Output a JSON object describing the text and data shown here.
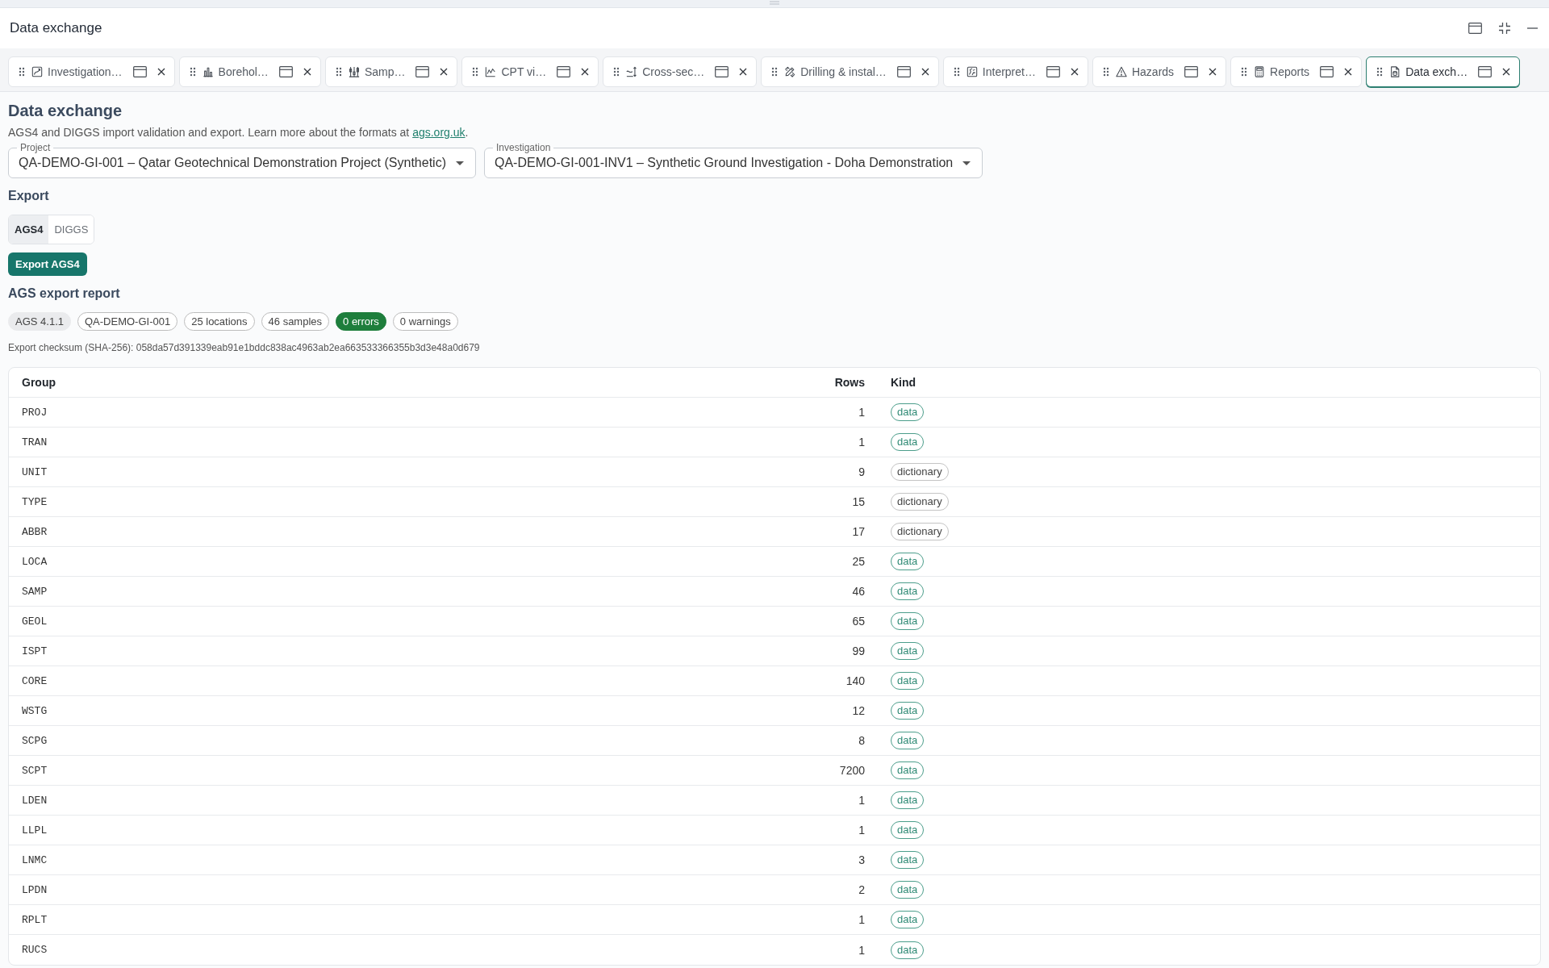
{
  "window": {
    "title": "Data exchange"
  },
  "tabs": [
    {
      "label": "Investigation…",
      "selected": false
    },
    {
      "label": "Borehol…",
      "selected": false
    },
    {
      "label": "Samp…",
      "selected": false
    },
    {
      "label": "CPT vi…",
      "selected": false
    },
    {
      "label": "Cross-sec…",
      "selected": false
    },
    {
      "label": "Drilling & instal…",
      "selected": false
    },
    {
      "label": "Interpret…",
      "selected": false
    },
    {
      "label": "Hazards",
      "selected": false
    },
    {
      "label": "Reports",
      "selected": false
    },
    {
      "label": "Data exch…",
      "selected": true
    }
  ],
  "page": {
    "heading": "Data exchange",
    "description": "AGS4 and DIGGS import validation and export. Learn more about the formats at ",
    "link": "ags.org.uk",
    "description_end": "."
  },
  "selects": [
    {
      "label": "Project",
      "value": "QA-DEMO-GI-001 – Qatar Geotechnical Demonstration Project (Synthetic)"
    },
    {
      "label": "Investigation",
      "value": "QA-DEMO-GI-001-INV1 – Synthetic Ground Investigation - Doha Demonstration"
    }
  ],
  "export": {
    "heading": "Export",
    "formats": [
      {
        "label": "AGS4",
        "selected": true
      },
      {
        "label": "DIGGS",
        "selected": false
      }
    ],
    "button": "Export AGS4"
  },
  "report": {
    "heading": "AGS export report",
    "badges": [
      {
        "label": "AGS 4.1.1",
        "kind": "version"
      },
      {
        "label": "QA-DEMO-GI-001",
        "kind": "info"
      },
      {
        "label": "25 locations",
        "kind": "info"
      },
      {
        "label": "46 samples",
        "kind": "info"
      },
      {
        "label": "0 errors",
        "kind": "success"
      },
      {
        "label": "0 warnings",
        "kind": "info"
      }
    ],
    "checksum": "Export checksum (SHA-256): 058da57d391339eab91e1bddc838ac4963ab2ea663533366355b3d3e48a0d679"
  },
  "table": {
    "columns": [
      "Group",
      "Rows",
      "Kind"
    ],
    "rows": [
      {
        "group": "PROJ",
        "rows": "1",
        "badge": {
          "label": "data",
          "kind": "data"
        }
      },
      {
        "group": "TRAN",
        "rows": "1",
        "badge": {
          "label": "data",
          "kind": "data"
        }
      },
      {
        "group": "UNIT",
        "rows": "9",
        "badge": {
          "label": "dictionary",
          "kind": "dictionary"
        }
      },
      {
        "group": "TYPE",
        "rows": "15",
        "badge": {
          "label": "dictionary",
          "kind": "dictionary"
        }
      },
      {
        "group": "ABBR",
        "rows": "17",
        "badge": {
          "label": "dictionary",
          "kind": "dictionary"
        }
      },
      {
        "group": "LOCA",
        "rows": "25",
        "badge": {
          "label": "data",
          "kind": "data"
        }
      },
      {
        "group": "SAMP",
        "rows": "46",
        "badge": {
          "label": "data",
          "kind": "data"
        }
      },
      {
        "group": "GEOL",
        "rows": "65",
        "badge": {
          "label": "data",
          "kind": "data"
        }
      },
      {
        "group": "ISPT",
        "rows": "99",
        "badge": {
          "label": "data",
          "kind": "data"
        }
      },
      {
        "group": "CORE",
        "rows": "140",
        "badge": {
          "label": "data",
          "kind": "data"
        }
      },
      {
        "group": "WSTG",
        "rows": "12",
        "badge": {
          "label": "data",
          "kind": "data"
        }
      },
      {
        "group": "SCPG",
        "rows": "8",
        "badge": {
          "label": "data",
          "kind": "data"
        }
      },
      {
        "group": "SCPT",
        "rows": "7200",
        "badge": {
          "label": "data",
          "kind": "data"
        }
      },
      {
        "group": "LDEN",
        "rows": "1",
        "badge": {
          "label": "data",
          "kind": "data"
        }
      },
      {
        "group": "LLPL",
        "rows": "1",
        "badge": {
          "label": "data",
          "kind": "data"
        }
      },
      {
        "group": "LNMC",
        "rows": "3",
        "badge": {
          "label": "data",
          "kind": "data"
        }
      },
      {
        "group": "LPDN",
        "rows": "2",
        "badge": {
          "label": "data",
          "kind": "data"
        }
      },
      {
        "group": "RPLT",
        "rows": "1",
        "badge": {
          "label": "data",
          "kind": "data"
        }
      },
      {
        "group": "RUCS",
        "rows": "1",
        "badge": {
          "label": "data",
          "kind": "data"
        }
      }
    ]
  }
}
